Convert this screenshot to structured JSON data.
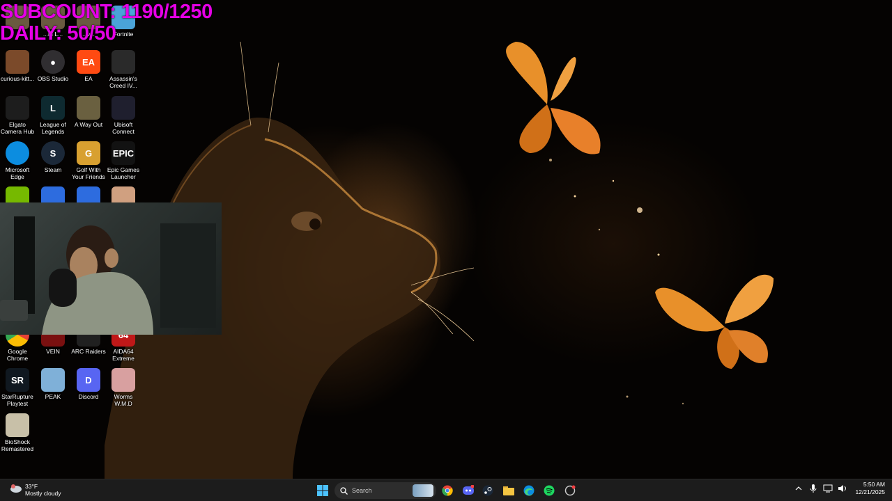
{
  "overlay": {
    "subcount": "SUBCOUNT: 1190/1250",
    "daily": "DAILY: 50/50",
    "color": "#e600e6"
  },
  "desktop_icons": [
    {
      "label": "",
      "icon": "partial-icon"
    },
    {
      "label": "...m L...",
      "icon": "partial-icon"
    },
    {
      "label": "...v...",
      "icon": "partial-icon"
    },
    {
      "label": "Fortnite",
      "icon": "fortnite-icon"
    },
    {
      "label": "curious-kitt...",
      "icon": "image-file-icon"
    },
    {
      "label": "OBS Studio",
      "icon": "obs-icon"
    },
    {
      "label": "EA",
      "icon": "ea-icon"
    },
    {
      "label": "Assassin's Creed IV...",
      "icon": "assassins-creed-icon"
    },
    {
      "label": "Elgato Camera Hub",
      "icon": "elgato-icon"
    },
    {
      "label": "League of Legends",
      "icon": "league-icon"
    },
    {
      "label": "A Way Out",
      "icon": "a-way-out-icon"
    },
    {
      "label": "Ubisoft Connect",
      "icon": "ubisoft-icon"
    },
    {
      "label": "Microsoft Edge",
      "icon": "edge-icon"
    },
    {
      "label": "Steam",
      "icon": "steam-icon"
    },
    {
      "label": "Golf With Your Friends",
      "icon": "golf-icon"
    },
    {
      "label": "Epic Games Launcher",
      "icon": "epic-icon"
    },
    {
      "label": "",
      "icon": "nvidia-icon"
    },
    {
      "label": "",
      "icon": "app-icon"
    },
    {
      "label": "",
      "icon": "app-icon"
    },
    {
      "label": "",
      "icon": "game-icon"
    },
    {
      "label": "Google Chrome",
      "icon": "chrome-icon"
    },
    {
      "label": "VEIN",
      "icon": "vein-icon"
    },
    {
      "label": "ARC Raiders",
      "icon": "arc-raiders-icon"
    },
    {
      "label": "AIDA64 Extreme",
      "icon": "aida64-icon"
    },
    {
      "label": "StarRupture Playtest",
      "icon": "starrupture-icon"
    },
    {
      "label": "PEAK",
      "icon": "peak-icon"
    },
    {
      "label": "Discord",
      "icon": "discord-icon"
    },
    {
      "label": "Worms W.M.D",
      "icon": "worms-icon"
    },
    {
      "label": "BioShock Remastered",
      "icon": "bioshock-icon"
    }
  ],
  "webcam": {
    "icon": "webcam-feed-icon"
  },
  "taskbar": {
    "weather": {
      "temp": "33°F",
      "condition": "Mostly cloudy"
    },
    "search_placeholder": "Search",
    "pinned": [
      "chrome-icon",
      "discord-icon",
      "steam-icon",
      "file-explorer-icon",
      "edge-icon",
      "spotify-icon",
      "app-icon"
    ],
    "time": "5:50 AM",
    "date": "12/21/2025"
  }
}
